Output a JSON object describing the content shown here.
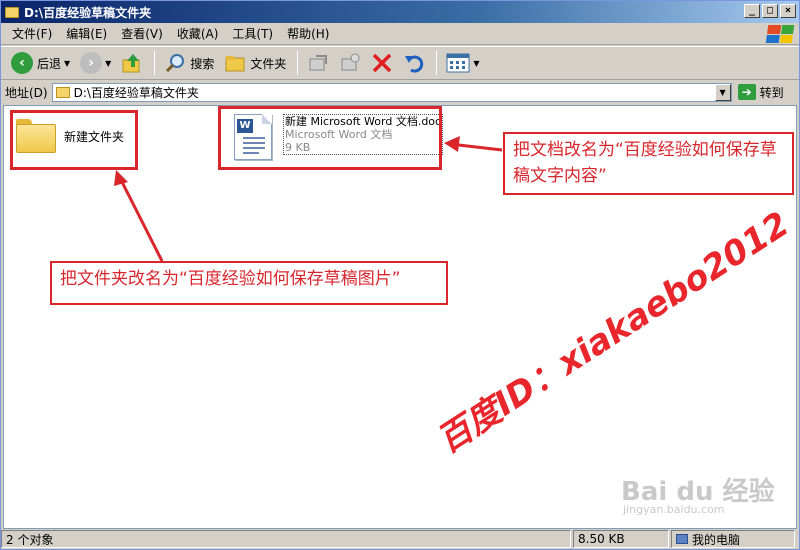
{
  "window": {
    "title": "D:\\百度经验草稿文件夹"
  },
  "window_buttons": [
    "_",
    "□",
    "×"
  ],
  "menu": [
    "文件(F)",
    "编辑(E)",
    "查看(V)",
    "收藏(A)",
    "工具(T)",
    "帮助(H)"
  ],
  "toolbar": {
    "back_label": "后退",
    "search_label": "搜索",
    "folders_label": "文件夹"
  },
  "address": {
    "label": "地址(D)",
    "value": "D:\\百度经验草稿文件夹",
    "go_label": "转到"
  },
  "files": {
    "folder_name": "新建文件夹",
    "doc_name": "新建 Microsoft Word 文档.doc",
    "doc_type": "Microsoft Word 文档",
    "doc_size": "9 KB"
  },
  "annotations": {
    "doc_callout": "把文档改名为“百度经验如何保存草稿文字内容”",
    "folder_callout": "把文件夹改名为“百度经验如何保存草稿图片”",
    "color": "#d9262c"
  },
  "watermark": {
    "text": "百度ID：xiakaebo2012",
    "logo": "Bai du 经验",
    "logo_sub": "jingyan.baidu.com"
  },
  "status": {
    "objects": "2 个对象",
    "size": "8.50 KB",
    "location": "我的电脑"
  }
}
